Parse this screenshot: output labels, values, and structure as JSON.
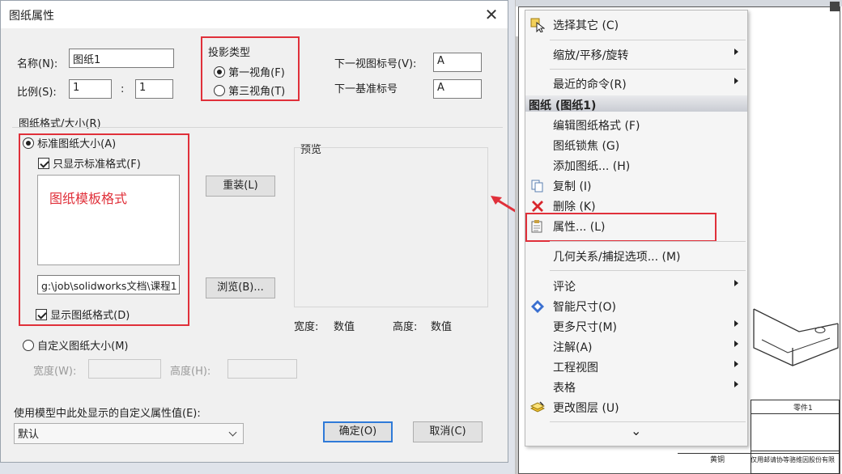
{
  "dialog": {
    "title": "图纸属性",
    "close_glyph": "✕",
    "name_label": "名称(N):",
    "name_value": "图纸1",
    "scale_label": "比例(S):",
    "scale_num": "1",
    "scale_sep": ":",
    "scale_den": "1",
    "projection": {
      "title": "投影类型",
      "first_angle": "第一视角(F)",
      "third_angle": "第三视角(T)",
      "selected": "first_angle"
    },
    "next_view_label": "下一视图标号(V):",
    "next_view_value": "A",
    "next_datum_label": "下一基准标号",
    "next_datum_value": "A",
    "format_group_label": "图纸格式/大小(R)",
    "standard_size": "标准图纸大小(A)",
    "only_standard": "只显示标准格式(F)",
    "template_annotation": "图纸模板格式",
    "reload_button": "重装(L)",
    "preview_label": "预览",
    "path_value": "g:\\job\\solidworks文档\\课程1",
    "browse_button": "浏览(B)...",
    "show_format": "显示图纸格式(D)",
    "width_label": "宽度:",
    "width_value": "数值",
    "height_label": "高度:",
    "height_value": "数值",
    "custom_size": "自定义图纸大小(M)",
    "custom_width_label": "宽度(W):",
    "custom_height_label": "高度(H):",
    "custom_props_label": "使用模型中此处显示的自定义属性值(E):",
    "custom_props_value": "默认",
    "ok_button": "确定(O)",
    "cancel_button": "取消(C)"
  },
  "context_menu": {
    "items": [
      {
        "label": "选择其它 (C)",
        "icon": "select-other-icon"
      },
      {
        "label": "缩放/平移/旋转",
        "submenu": true
      },
      {
        "label": "最近的命令(R)",
        "submenu": true
      },
      {
        "label": "编辑图纸格式 (F)"
      },
      {
        "label": "图纸锁焦 (G)"
      },
      {
        "label": "添加图纸... (H)"
      },
      {
        "label": "复制 (I)",
        "icon": "copy-icon"
      },
      {
        "label": "删除 (K)",
        "icon": "delete-icon"
      },
      {
        "label": "属性... (L)",
        "icon": "properties-icon"
      },
      {
        "label": "几何关系/捕捉选项... (M)"
      },
      {
        "label": "评论",
        "submenu": true
      },
      {
        "label": "智能尺寸(O)",
        "icon": "smart-dimension-icon"
      },
      {
        "label": "更多尺寸(M)",
        "submenu": true
      },
      {
        "label": "注解(A)",
        "submenu": true
      },
      {
        "label": "工程视图",
        "submenu": true
      },
      {
        "label": "表格",
        "submenu": true
      },
      {
        "label": "更改图层 (U)",
        "icon": "change-layer-icon"
      }
    ],
    "section_header": "图纸 (图纸1)",
    "expand_glyph": "⌄"
  },
  "drawing": {
    "title_block_part": "零件1",
    "material": "黄铜",
    "footer_text": "仅用邮请协等骆维因股份有限"
  },
  "colors": {
    "highlight_red": "#e0303a",
    "annotation_red": "#e0303a",
    "primary_button_border": "#2f7ad8"
  }
}
